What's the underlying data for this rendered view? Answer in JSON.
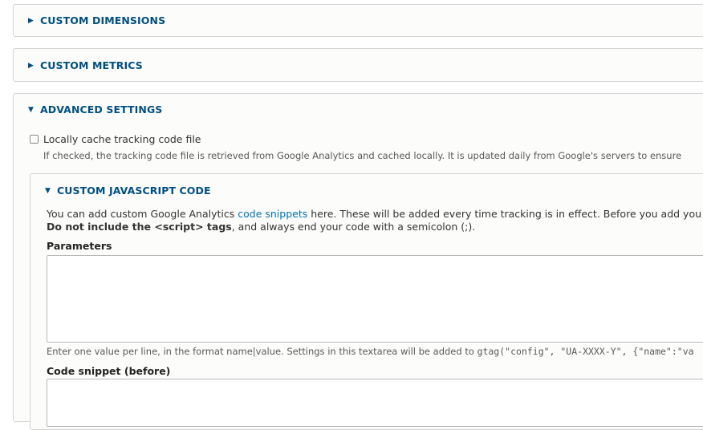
{
  "sections": {
    "custom_dimensions": {
      "label": "CUSTOM DIMENSIONS",
      "icon": "triangle-right-icon"
    },
    "custom_metrics": {
      "label": "CUSTOM METRICS",
      "icon": "triangle-right-icon"
    },
    "advanced_settings": {
      "label": "ADVANCED SETTINGS",
      "icon": "triangle-down-icon"
    }
  },
  "cache_option": {
    "label": "Locally cache tracking code file",
    "checked": false,
    "description": "If checked, the tracking code file is retrieved from Google Analytics and cached locally. It is updated daily from Google's servers to ensure"
  },
  "custom_js": {
    "title": "CUSTOM JAVASCRIPT CODE",
    "intro_before_link": "You can add custom Google Analytics ",
    "intro_link": "code snippets",
    "intro_after_link": " here. These will be added every time tracking is in effect. Before you add you",
    "warning_bold": "Do not include the <script> tags",
    "warning_rest": ", and always end your code with a semicolon (;).",
    "parameters": {
      "label": "Parameters",
      "value": "",
      "help_before": "Enter one value per line, in the format name|value. Settings in this textarea will be added to ",
      "help_code": "gtag(\"config\", \"UA-XXXX-Y\", {\"name\":\"va"
    },
    "code_snippet_before": {
      "label": "Code snippet (before)",
      "value": ""
    }
  },
  "colors": {
    "accent": "#004f80",
    "link": "#0071b3",
    "border": "#d4d4d4"
  }
}
